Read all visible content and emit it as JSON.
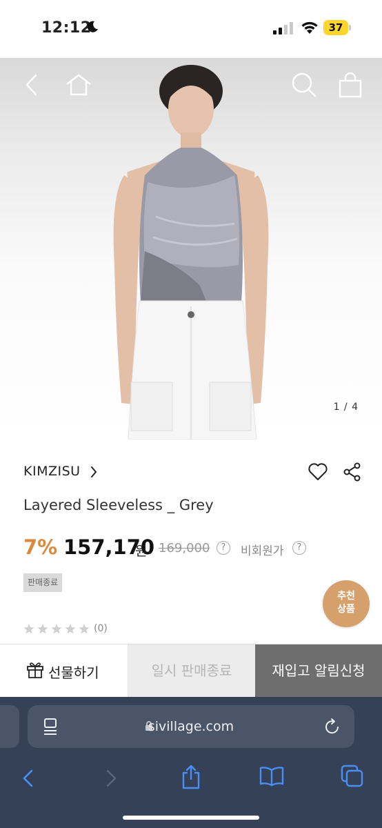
{
  "status_bar": {
    "time": "12:12",
    "battery": "37",
    "moon_icon": "moon-icon",
    "battery_color": "#ffd52e"
  },
  "hero": {
    "pager": "1 / 4",
    "icons": [
      "back-icon",
      "home-icon",
      "search-icon",
      "shopping-bag-icon"
    ]
  },
  "product": {
    "brand": "KIMZISU",
    "name": "Layered Sleeveless _ Grey",
    "discount": "7%",
    "price": "157,170",
    "currency": "원",
    "original_price": "169,000",
    "price_help": "?",
    "nonmember_label": "비회원가",
    "nonmember_help": "?",
    "status_badge": "판매종료",
    "rating_count": "(0)",
    "stars": 0,
    "discount_color": "#d98a3c"
  },
  "recommend": {
    "line1": "추천",
    "line2": "상품",
    "color": "#d6a06c"
  },
  "actions": {
    "gift": "선물하기",
    "soldout": "일시 판매종료",
    "restock": "재입고 알림신청"
  },
  "browser": {
    "url": "sivillage.com",
    "toolbar_icons": [
      "back-icon",
      "forward-icon",
      "share-icon",
      "bookmarks-icon",
      "tabs-icon"
    ],
    "accent": "#4a8ff7"
  }
}
